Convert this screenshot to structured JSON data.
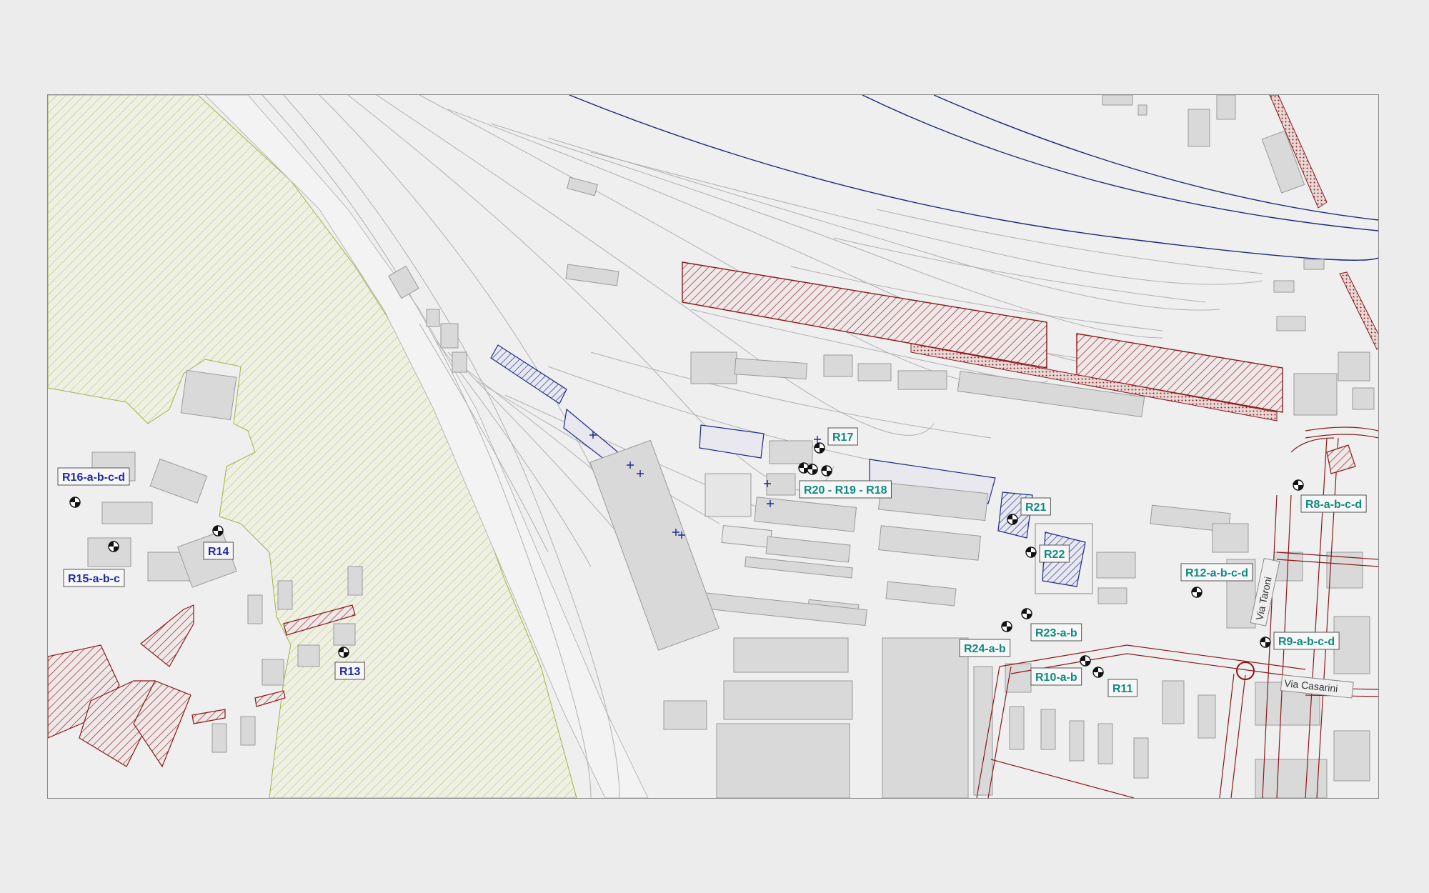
{
  "colors": {
    "receptor_teal": "#0f8a80",
    "receptor_blue": "#1f2aa8",
    "rail_blue": "#1a2a7a",
    "hatch_red": "#8a1a1a",
    "hatch_blue": "#1a2a8a",
    "green_area": "#a8b040"
  },
  "icons": {
    "receptor": "receptor-point-icon",
    "cross": "cross-marker-icon"
  },
  "receptors": [
    {
      "label": "R17",
      "color": "teal"
    },
    {
      "label": "R20 - R19 - R18",
      "color": "teal"
    },
    {
      "label": "R21",
      "color": "teal"
    },
    {
      "label": "R22",
      "color": "teal"
    },
    {
      "label": "R8-a-b-c-d",
      "color": "teal"
    },
    {
      "label": "R12-a-b-c-d",
      "color": "teal"
    },
    {
      "label": "R23-a-b",
      "color": "teal"
    },
    {
      "label": "R24-a-b",
      "color": "teal"
    },
    {
      "label": "R9-a-b-c-d",
      "color": "teal"
    },
    {
      "label": "R10-a-b",
      "color": "teal"
    },
    {
      "label": "R11",
      "color": "teal"
    },
    {
      "label": "R16-a-b-c-d",
      "color": "blue"
    },
    {
      "label": "R14",
      "color": "blue"
    },
    {
      "label": "R15-a-b-c",
      "color": "blue"
    },
    {
      "label": "R13",
      "color": "blue"
    }
  ],
  "streets": [
    {
      "name": "Via Taroni"
    },
    {
      "name": "Via Casarini"
    }
  ]
}
